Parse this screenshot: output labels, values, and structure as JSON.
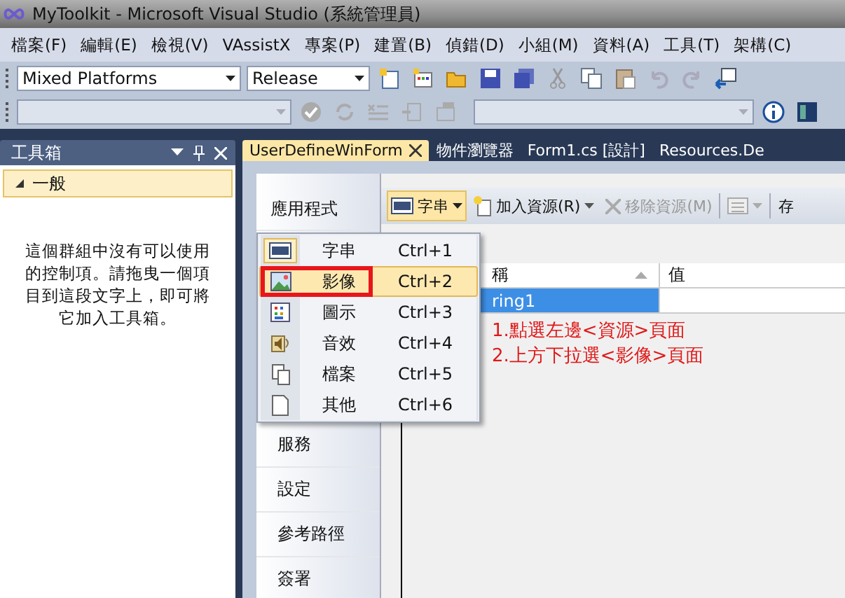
{
  "window": {
    "title": "MyToolkit - Microsoft Visual Studio (系統管理員)"
  },
  "menu_bar": [
    "檔案(F)",
    "編輯(E)",
    "檢視(V)",
    "VAssistX",
    "專案(P)",
    "建置(B)",
    "偵錯(D)",
    "小組(M)",
    "資料(A)",
    "工具(T)",
    "架構(C)"
  ],
  "toolbar": {
    "platform": "Mixed Platforms",
    "configuration": "Release"
  },
  "toolbox": {
    "title": "工具箱",
    "group": {
      "label": "一般",
      "expanded": true
    },
    "empty_message": "這個群組中沒有可以使用的控制項。請拖曳一個項目到這段文字上，即可將它加入工具箱。"
  },
  "document_tabs": [
    {
      "label": "UserDefineWinForm",
      "selected": true
    },
    {
      "label": "物件瀏覽器",
      "selected": false
    },
    {
      "label": "Form1.cs [設計]",
      "selected": false
    },
    {
      "label": "Resources.De",
      "selected": false
    }
  ],
  "designer": {
    "side_tabs": [
      {
        "label": "應用程式",
        "selected": false
      },
      {
        "label": "服務",
        "selected": false
      },
      {
        "label": "設定",
        "selected": false
      },
      {
        "label": "參考路徑",
        "selected": false
      },
      {
        "label": "簽署",
        "selected": false
      }
    ],
    "resource_toolbar": {
      "type_button": "字串",
      "add_button": "加入資源(R)",
      "remove_button": "移除資源(M)",
      "cut_button": "存"
    },
    "columns": [
      "稱",
      "值"
    ],
    "rows": [
      {
        "name": "ring1",
        "value": "",
        "selected": true
      }
    ],
    "type_menu": [
      {
        "kind": "string",
        "label": "字串",
        "shortcut": "Ctrl+1",
        "checked": true,
        "selected": false
      },
      {
        "kind": "image",
        "label": "影像",
        "shortcut": "Ctrl+2",
        "checked": false,
        "selected": true
      },
      {
        "kind": "icon",
        "label": "圖示",
        "shortcut": "Ctrl+3",
        "checked": false,
        "selected": false
      },
      {
        "kind": "audio",
        "label": "音效",
        "shortcut": "Ctrl+4",
        "checked": false,
        "selected": false
      },
      {
        "kind": "file",
        "label": "檔案",
        "shortcut": "Ctrl+5",
        "checked": false,
        "selected": false
      },
      {
        "kind": "other",
        "label": "其他",
        "shortcut": "Ctrl+6",
        "checked": false,
        "selected": false
      }
    ],
    "annotations": [
      "1.點選左邊<資源>頁面",
      "2.上方下拉選<影像>頁面"
    ]
  }
}
